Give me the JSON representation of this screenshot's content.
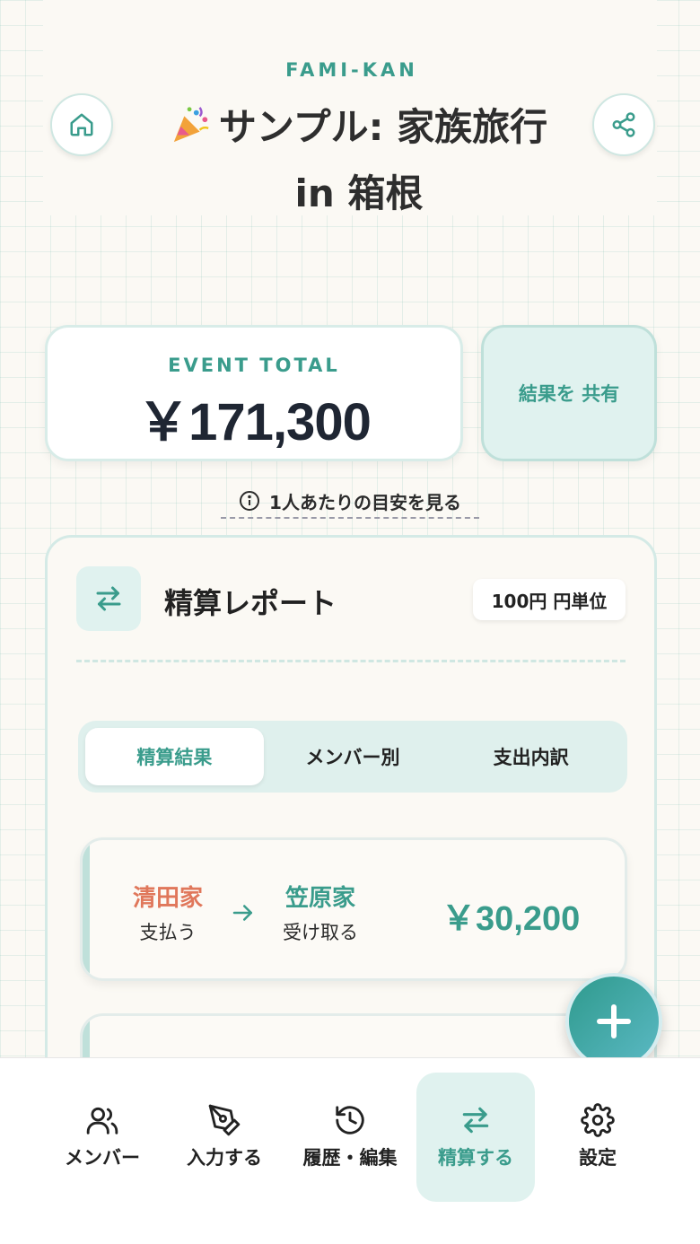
{
  "brand": "FAMI-KAN",
  "header": {
    "emoji": "🎉",
    "title_line1": "サンプル: 家族旅行",
    "title_line2": "in 箱根"
  },
  "total": {
    "label": "EVENT TOTAL",
    "value": "￥171,300"
  },
  "share_result_label": "結果を 共有",
  "per_person_link": "1人あたりの目安を見る",
  "report": {
    "title": "精算レポート",
    "unit_badge": "100円 円単位",
    "tabs": [
      {
        "label": "精算結果",
        "active": true
      },
      {
        "label": "メンバー別",
        "active": false
      },
      {
        "label": "支出内訳",
        "active": false
      }
    ],
    "settlements": [
      {
        "payer": "清田家",
        "payer_role": "支払う",
        "payee": "笠原家",
        "payee_role": "受け取る",
        "amount": "￥30,200"
      }
    ]
  },
  "nav": [
    {
      "label": "メンバー",
      "icon": "members-icon",
      "active": false
    },
    {
      "label": "入力する",
      "icon": "pen-icon",
      "active": false
    },
    {
      "label": "履歴・編集",
      "icon": "history-icon",
      "active": false
    },
    {
      "label": "精算する",
      "icon": "transfer-icon",
      "active": true
    },
    {
      "label": "設定",
      "icon": "gear-icon",
      "active": false
    }
  ],
  "colors": {
    "accent": "#3a9c8c",
    "payer": "#e0775b",
    "accent_light": "#e0f2ef"
  }
}
